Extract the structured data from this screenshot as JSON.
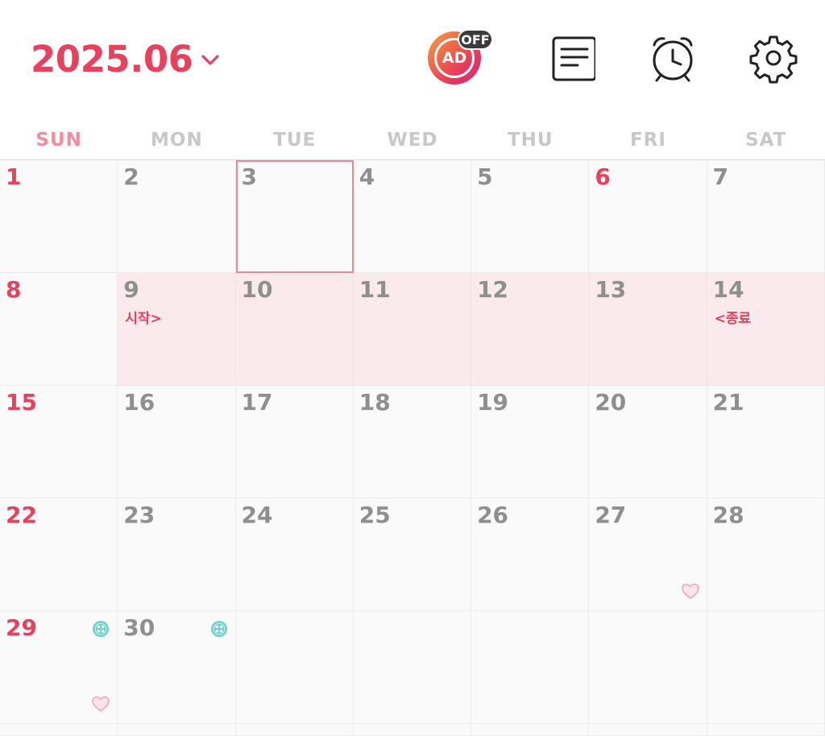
{
  "header": {
    "month_title": "2025.06",
    "ad_label": "AD",
    "ad_status": "OFF",
    "icons": [
      "chevron-down-icon",
      "ad-off-icon",
      "memo-icon",
      "alarm-clock-icon",
      "gear-icon"
    ]
  },
  "weekdays": [
    "SUN",
    "MON",
    "TUE",
    "WED",
    "THU",
    "FRI",
    "SAT"
  ],
  "colors": {
    "accent": "#e8415e",
    "range_highlight": "#faeaed",
    "mark_teal": "#6ccfcb",
    "mark_heart": "#f3a6b7"
  },
  "calendar": {
    "today": "3",
    "weeks": [
      [
        {
          "day": "1",
          "red": true
        },
        {
          "day": "2"
        },
        {
          "day": "3",
          "today": true
        },
        {
          "day": "4"
        },
        {
          "day": "5"
        },
        {
          "day": "6",
          "red": true
        },
        {
          "day": "7"
        }
      ],
      [
        {
          "day": "8",
          "red": true
        },
        {
          "day": "9",
          "range": true,
          "note": "시작>"
        },
        {
          "day": "10",
          "range": true
        },
        {
          "day": "11",
          "range": true
        },
        {
          "day": "12",
          "range": true
        },
        {
          "day": "13",
          "range": true
        },
        {
          "day": "14",
          "range": true,
          "note": "<종료"
        }
      ],
      [
        {
          "day": "15",
          "red": true
        },
        {
          "day": "16"
        },
        {
          "day": "17"
        },
        {
          "day": "18"
        },
        {
          "day": "19"
        },
        {
          "day": "20"
        },
        {
          "day": "21"
        }
      ],
      [
        {
          "day": "22",
          "red": true
        },
        {
          "day": "23"
        },
        {
          "day": "24"
        },
        {
          "day": "25"
        },
        {
          "day": "26"
        },
        {
          "day": "27",
          "heart": true
        },
        {
          "day": "28"
        }
      ],
      [
        {
          "day": "29",
          "red": true,
          "button": true,
          "heart": true
        },
        {
          "day": "30",
          "button": true
        },
        {
          "day": ""
        },
        {
          "day": ""
        },
        {
          "day": ""
        },
        {
          "day": ""
        },
        {
          "day": ""
        }
      ]
    ]
  }
}
